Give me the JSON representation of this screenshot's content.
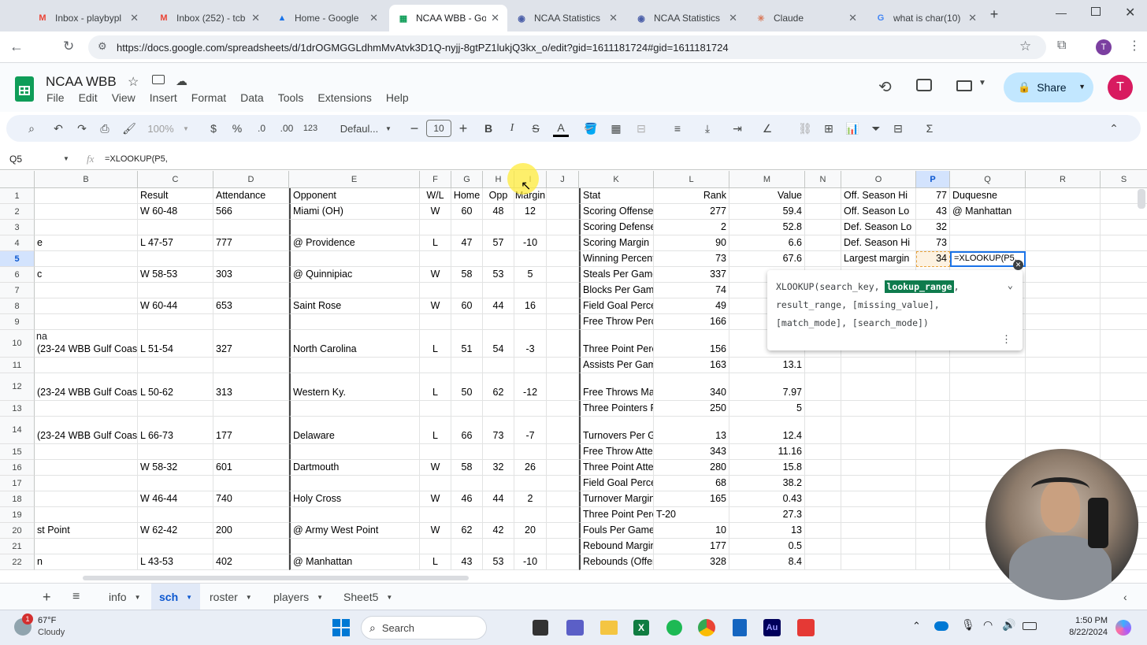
{
  "browser": {
    "tabs": [
      {
        "title": "Inbox - playbypl",
        "icon": "gmail-icon",
        "color": "#ea4335",
        "glyph": "M"
      },
      {
        "title": "Inbox (252) - tcb",
        "icon": "gmail-icon",
        "color": "#ea4335",
        "glyph": "M"
      },
      {
        "title": "Home - Google",
        "icon": "drive-icon",
        "color": "#1a73e8",
        "glyph": "▲"
      },
      {
        "title": "NCAA WBB - Go",
        "icon": "sheets-icon",
        "color": "#0f9d58",
        "glyph": "▦"
      },
      {
        "title": "NCAA Statistics",
        "icon": "ncaa-icon",
        "color": "#4a5ea8",
        "glyph": "◉"
      },
      {
        "title": "NCAA Statistics",
        "icon": "ncaa-icon",
        "color": "#4a5ea8",
        "glyph": "◉"
      },
      {
        "title": "Claude",
        "icon": "claude-icon",
        "color": "#d97757",
        "glyph": "✳"
      },
      {
        "title": "what is char(10)",
        "icon": "google-icon",
        "color": "#4285f4",
        "glyph": "G"
      }
    ],
    "url": "https://docs.google.com/spreadsheets/d/1drOGMGGLdhmMvAtvk3D1Q-nyjj-8gtPZ1lukjQ3kx_o/edit?gid=1611181724#gid=1611181724",
    "profile_initial": "T"
  },
  "doc": {
    "title": "NCAA WBB",
    "menus": [
      "File",
      "Edit",
      "View",
      "Insert",
      "Format",
      "Data",
      "Tools",
      "Extensions",
      "Help"
    ],
    "share_label": "Share",
    "avatar_initial": "T"
  },
  "toolbar": {
    "zoom": "100%",
    "currency": "$",
    "percent": "%",
    "dec_decrease": ".0",
    "dec_increase": ".00",
    "number_format": "123",
    "font": "Defaul...",
    "font_size": "10",
    "bold": "B",
    "italic": "I",
    "strike": "S",
    "text_color": "A",
    "sigma": "Σ"
  },
  "formula_bar": {
    "cell_ref": "Q5",
    "fx": "fx",
    "formula": "=XLOOKUP(P5,"
  },
  "columns": [
    {
      "label": "B",
      "w": 131
    },
    {
      "label": "C",
      "w": 96
    },
    {
      "label": "D",
      "w": 96
    },
    {
      "label": "E",
      "w": 166
    },
    {
      "label": "F",
      "w": 40
    },
    {
      "label": "G",
      "w": 40
    },
    {
      "label": "H",
      "w": 40
    },
    {
      "label": "I",
      "w": 41
    },
    {
      "label": "J",
      "w": 41
    },
    {
      "label": "K",
      "w": 95
    },
    {
      "label": "L",
      "w": 96
    },
    {
      "label": "M",
      "w": 96
    },
    {
      "label": "N",
      "w": 46
    },
    {
      "label": "O",
      "w": 95
    },
    {
      "label": "P",
      "w": 43
    },
    {
      "label": "Q",
      "w": 96
    },
    {
      "label": "R",
      "w": 95
    },
    {
      "label": "S",
      "w": 60
    }
  ],
  "rows": [
    {
      "n": "1",
      "h": 20,
      "cells": [
        "",
        "Result",
        "Attendance",
        "Opponent",
        "W/L",
        "Home",
        "Opp",
        "Margin",
        "",
        "Stat",
        "Rank",
        "Value",
        "",
        "Off. Season Hi",
        "77",
        "Duquesne",
        "",
        ""
      ]
    },
    {
      "n": "2",
      "h": 20,
      "cells": [
        "",
        "W 60-48",
        "566",
        "Miami (OH)",
        "W",
        "60",
        "48",
        "12",
        "",
        "Scoring Offense",
        "277",
        "59.4",
        "",
        "Off. Season Lo",
        "43",
        "@ Manhattan",
        "",
        ""
      ]
    },
    {
      "n": "3",
      "h": 20,
      "cells": [
        "",
        "",
        "",
        "",
        "",
        "",
        "",
        "",
        "",
        "Scoring Defense",
        "2",
        "52.8",
        "",
        "Def. Season Lo",
        "32",
        "",
        "",
        ""
      ]
    },
    {
      "n": "4",
      "h": 20,
      "cells": [
        "e",
        "L 47-57",
        "777",
        "@ Providence",
        "L",
        "47",
        "57",
        "-10",
        "",
        "Scoring Margin",
        "90",
        "6.6",
        "",
        "Def. Season Hi",
        "73",
        "",
        "",
        ""
      ]
    },
    {
      "n": "5",
      "h": 20,
      "cells": [
        "",
        "",
        "",
        "",
        "",
        "",
        "",
        "",
        "",
        "Winning Percent",
        "73",
        "67.6",
        "",
        "Largest margin",
        "34",
        "=XLOOKUP(P5,",
        "",
        ""
      ]
    },
    {
      "n": "6",
      "h": 20,
      "cells": [
        "c",
        "W 58-53",
        "303",
        "@ Quinnipiac",
        "W",
        "58",
        "53",
        "5",
        "",
        "Steals Per Game",
        "337",
        "",
        "",
        "",
        "",
        "",
        "",
        ""
      ]
    },
    {
      "n": "7",
      "h": 20,
      "cells": [
        "",
        "",
        "",
        "",
        "",
        "",
        "",
        "",
        "",
        "Blocks Per Gam",
        "74",
        "",
        "",
        "",
        "",
        "",
        "",
        ""
      ]
    },
    {
      "n": "8",
      "h": 20,
      "cells": [
        "",
        "W 60-44",
        "653",
        "Saint Rose",
        "W",
        "60",
        "44",
        "16",
        "",
        "Field Goal Perce",
        "49",
        "",
        "",
        "",
        "",
        "",
        "",
        ""
      ]
    },
    {
      "n": "9",
      "h": 20,
      "cells": [
        "",
        "",
        "",
        "",
        "",
        "",
        "",
        "",
        "",
        "Free Throw Perc",
        "166",
        "",
        "",
        "",
        "",
        "",
        "",
        ""
      ]
    },
    {
      "n": "10",
      "h": 35,
      "cells": [
        "(23-24 WBB Gulf Coas",
        "L 51-54",
        "327",
        "North Carolina",
        "L",
        "51",
        "54",
        "-3",
        "",
        "Three Point Perc",
        "156",
        "",
        "",
        "",
        "",
        "",
        "",
        ""
      ]
    },
    {
      "n": "11",
      "h": 20,
      "cells": [
        "",
        "",
        "",
        "",
        "",
        "",
        "",
        "",
        "",
        "Assists Per Gam",
        "163",
        "13.1",
        "",
        "",
        "",
        "",
        "",
        ""
      ]
    },
    {
      "n": "12",
      "h": 35,
      "cells": [
        "(23-24 WBB Gulf Coas",
        "L 50-62",
        "313",
        "Western Ky.",
        "L",
        "50",
        "62",
        "-12",
        "",
        "Free Throws Ma",
        "340",
        "7.97",
        "",
        "",
        "",
        "",
        "",
        ""
      ]
    },
    {
      "n": "13",
      "h": 20,
      "cells": [
        "",
        "",
        "",
        "",
        "",
        "",
        "",
        "",
        "",
        "Three Pointers F",
        "250",
        "5",
        "",
        "",
        "",
        "",
        "",
        ""
      ]
    },
    {
      "n": "14",
      "h": 35,
      "cells": [
        "(23-24 WBB Gulf Coas",
        "L 66-73",
        "177",
        "Delaware",
        "L",
        "66",
        "73",
        "-7",
        "",
        "Turnovers Per G",
        "13",
        "12.4",
        "",
        "",
        "",
        "",
        "",
        ""
      ]
    },
    {
      "n": "15",
      "h": 20,
      "cells": [
        "",
        "",
        "",
        "",
        "",
        "",
        "",
        "",
        "",
        "Free Throw Atte",
        "343",
        "11.16",
        "",
        "",
        "",
        "",
        "",
        ""
      ]
    },
    {
      "n": "16",
      "h": 20,
      "cells": [
        "",
        "W 58-32",
        "601",
        "Dartmouth",
        "W",
        "58",
        "32",
        "26",
        "",
        "Three Point Atte",
        "280",
        "15.8",
        "",
        "",
        "",
        "",
        "",
        ""
      ]
    },
    {
      "n": "17",
      "h": 20,
      "cells": [
        "",
        "",
        "",
        "",
        "",
        "",
        "",
        "",
        "",
        "Field Goal Perce",
        "68",
        "38.2",
        "",
        "",
        "",
        "",
        "",
        ""
      ]
    },
    {
      "n": "18",
      "h": 20,
      "cells": [
        "",
        "W 46-44",
        "740",
        "Holy Cross",
        "W",
        "46",
        "44",
        "2",
        "",
        "Turnover Margin",
        "165",
        "0.43",
        "",
        "",
        "",
        "",
        "",
        ""
      ]
    },
    {
      "n": "19",
      "h": 20,
      "cells": [
        "",
        "",
        "",
        "",
        "",
        "",
        "",
        "",
        "",
        "Three Point Perc",
        "T-20",
        "27.3",
        "",
        "",
        "",
        "",
        "",
        ""
      ]
    },
    {
      "n": "20",
      "h": 20,
      "cells": [
        "st Point",
        "W 62-42",
        "200",
        "@ Army West Point",
        "W",
        "62",
        "42",
        "20",
        "",
        "Fouls Per Game",
        "10",
        "13",
        "",
        "",
        "",
        "",
        "",
        ""
      ]
    },
    {
      "n": "21",
      "h": 20,
      "cells": [
        "",
        "",
        "",
        "",
        "",
        "",
        "",
        "",
        "",
        "Rebound Margin",
        "177",
        "0.5",
        "",
        "",
        "",
        "",
        "",
        ""
      ]
    },
    {
      "n": "22",
      "h": 20,
      "cells": [
        "n",
        "L 43-53",
        "402",
        "@ Manhattan",
        "L",
        "43",
        "53",
        "-10",
        "",
        "Rebounds (Offer",
        "328",
        "8.4",
        "",
        "",
        "",
        "",
        "",
        ""
      ]
    }
  ],
  "row10_extra": "na",
  "tooltip": {
    "fn": "XLOOKUP(search_key, ",
    "highlight": "lookup_range",
    "rest1": ",",
    "line2": "result_range, [missing_value],",
    "line3": "[match_mode], [search_mode])"
  },
  "sheet_tabs": [
    {
      "label": "info",
      "active": false
    },
    {
      "label": "sch",
      "active": true
    },
    {
      "label": "roster",
      "active": false
    },
    {
      "label": "players",
      "active": false
    },
    {
      "label": "Sheet5",
      "active": false
    }
  ],
  "taskbar": {
    "weather_temp": "67°F",
    "weather_desc": "Cloudy",
    "weather_badge": "1",
    "search_label": "Search",
    "time": "1:50 PM",
    "date": "8/22/2024"
  }
}
